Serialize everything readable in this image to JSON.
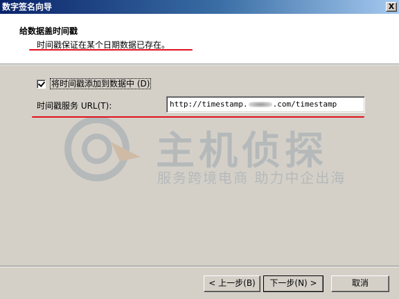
{
  "window": {
    "title": "数字签名向导",
    "close_label": "X"
  },
  "header": {
    "title": "给数据盖时间戳",
    "subtitle": "时间戳保证在某个日期数据已存在。"
  },
  "options": {
    "add_timestamp_label": "将时间戳添加到数据中 (D)",
    "add_timestamp_checked": true,
    "url_label": "时间戳服务 URL(T):",
    "url_value_prefix": "http://timestamp.",
    "url_value_suffix": ".com/timestamp"
  },
  "watermark": {
    "title": "主机侦探",
    "slogan": "服务跨境电商 助力中企出海"
  },
  "buttons": {
    "back": "< 上一步(B)",
    "next": "下一步(N) >",
    "cancel": "取消"
  },
  "colors": {
    "title_bar_start": "#0a246a",
    "title_bar_end": "#a6caf0",
    "annotation_red": "#e0101a",
    "dialog_face": "#d4d0c8"
  }
}
